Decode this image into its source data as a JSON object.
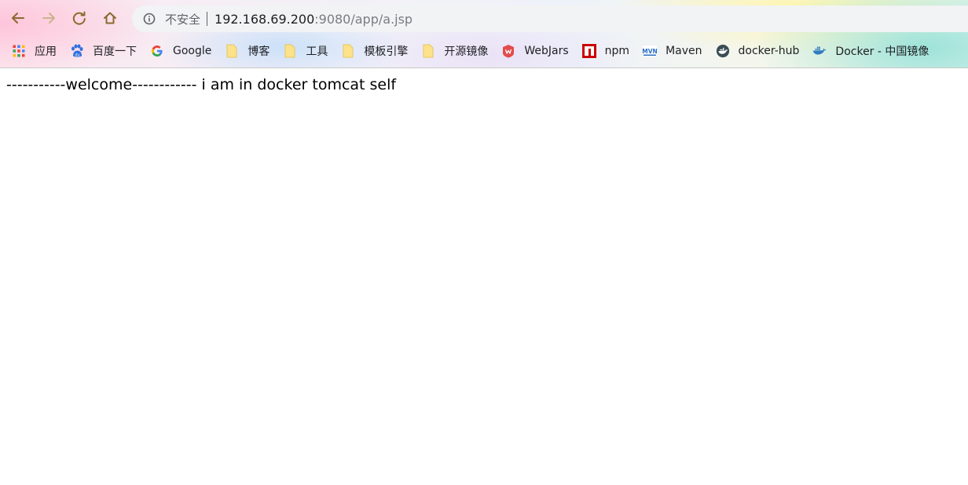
{
  "browser": {
    "nav": {
      "back_icon": "back-arrow-icon",
      "forward_icon": "forward-arrow-icon",
      "reload_icon": "reload-icon",
      "home_icon": "home-icon"
    },
    "omnibox": {
      "info_icon": "info-icon",
      "security_label": "不安全",
      "url_host": "192.168.69.200",
      "url_rest": ":9080/app/a.jsp"
    },
    "bookmarks": [
      {
        "label": "应用",
        "icon": "apps-grid-icon"
      },
      {
        "label": "百度一下",
        "icon": "baidu-paw-icon"
      },
      {
        "label": "Google",
        "icon": "google-g-icon"
      },
      {
        "label": "博客",
        "icon": "folder-icon"
      },
      {
        "label": "工具",
        "icon": "folder-icon"
      },
      {
        "label": "模板引擎",
        "icon": "folder-icon"
      },
      {
        "label": "开源镜像",
        "icon": "folder-icon"
      },
      {
        "label": "WebJars",
        "icon": "webjars-icon"
      },
      {
        "label": "npm",
        "icon": "npm-icon"
      },
      {
        "label": "Maven",
        "icon": "maven-icon"
      },
      {
        "label": "docker-hub",
        "icon": "docker-hub-icon"
      },
      {
        "label": "Docker - 中国镜像",
        "icon": "docker-whale-icon"
      }
    ]
  },
  "page": {
    "body_text": "-----------welcome------------ i am in docker tomcat self"
  },
  "colors": {
    "icon_brown": "#8a6a2e",
    "folder_yellow": "#fce28a",
    "omnibox_bg": "#f1f3f4"
  }
}
